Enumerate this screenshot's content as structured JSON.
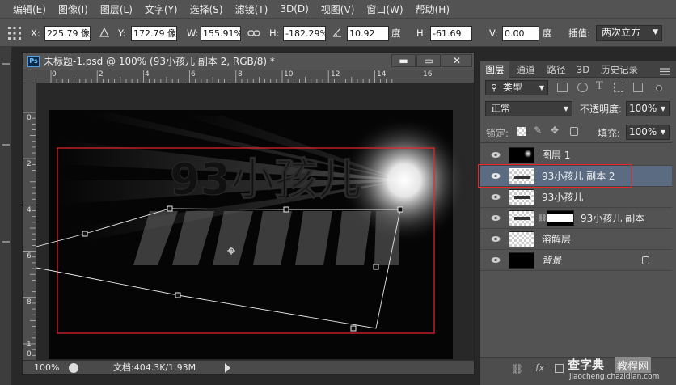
{
  "menu": [
    "编辑(E)",
    "图像(I)",
    "图层(L)",
    "文字(Y)",
    "选择(S)",
    "滤镜(T)",
    "3D(D)",
    "视图(V)",
    "窗口(W)",
    "帮助(H)"
  ],
  "options": {
    "x_label": "X:",
    "x_value": "225.79 像素",
    "y_label": "Y:",
    "y_value": "172.79 像素",
    "w_label": "W:",
    "w_value": "155.91%",
    "h_label": "H:",
    "h_value": "-182.29%",
    "angle_value": "10.92",
    "angle_unit": "度",
    "hskew_label": "H:",
    "hskew_value": "-61.69",
    "vskew_label": "V:",
    "vskew_value": "0.00",
    "vskew_unit": "度",
    "interp_label": "插值:",
    "interp_value": "两次立方"
  },
  "document": {
    "title": "未标题-1.psd @ 100% (93小孩儿 副本 2, RGB/8) *",
    "ps_badge": "Ps",
    "minimize": "▬",
    "maximize": "▭",
    "close": "✕",
    "hruler_labels": [
      "0",
      "2",
      "4",
      "6",
      "8",
      "10",
      "12",
      "14",
      "16"
    ],
    "vruler_labels": [
      "0",
      "2",
      "4",
      "6",
      "8",
      "1",
      "0"
    ],
    "artwork_text": "93小孩儿",
    "zoom": "100%",
    "doc_info": "文档:404.3K/1.93M"
  },
  "panel": {
    "tabs": [
      "图层",
      "通道",
      "路径",
      "3D",
      "历史记录"
    ],
    "filter_kind": "类型",
    "blend_mode": "正常",
    "opacity_label": "不透明度:",
    "opacity_value": "100%",
    "lock_label": "锁定:",
    "fill_label": "填充:",
    "fill_value": "100%",
    "layers": [
      {
        "name": "图层 1"
      },
      {
        "name": "93小孩儿 副本 2"
      },
      {
        "name": "93小孩儿"
      },
      {
        "name": "93小孩儿 副本"
      },
      {
        "name": "溶解层"
      },
      {
        "name": "背景"
      }
    ],
    "footer_fx": "fx"
  },
  "watermark": {
    "line1": "查字典",
    "line2": "教程网",
    "url": "jiaocheng.chazidian.com"
  },
  "colors": {
    "highlight": "#e8272b",
    "panel_bg": "#535353",
    "selected_layer": "#5b6c82"
  }
}
